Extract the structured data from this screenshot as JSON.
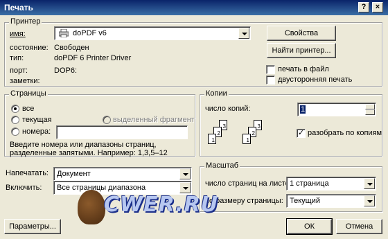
{
  "window": {
    "title": "Печать",
    "help_button": "?",
    "close_button": "×"
  },
  "printer": {
    "legend": "Принтер",
    "name_label": "имя:",
    "name_value": "doPDF v6",
    "status_label": "состояние:",
    "status_value": "Свободен",
    "type_label": "тип:",
    "type_value": "doPDF  6 Printer Driver",
    "port_label": "порт:",
    "port_value": "DOP6:",
    "notes_label": "заметки:",
    "properties_button": "Свойства",
    "find_printer_button": "Найти принтер...",
    "print_to_file_label": "печать в файл",
    "duplex_label": "двусторонняя печать"
  },
  "pages": {
    "legend": "Страницы",
    "all_label": "все",
    "current_label": "текущая",
    "selection_label": "выделенный фрагмент",
    "numbers_label": "номера:",
    "numbers_value": "",
    "hint": "Введите номера или диапазоны страниц, разделенные запятыми. Например: 1,3,5–12"
  },
  "copies": {
    "legend": "Копии",
    "count_label": "число копий:",
    "count_value": "1",
    "collate_label": "разобрать по копиям"
  },
  "print_what": {
    "print_label": "Напечатать:",
    "print_value": "Документ",
    "include_label": "Включить:",
    "include_value": "Все страницы диапазона"
  },
  "zoom": {
    "legend": "Масштаб",
    "pages_per_sheet_label": "число страниц на листе:",
    "pages_per_sheet_value": "1 страница",
    "scale_label": "по размеру страницы:",
    "scale_value": "Текущий"
  },
  "footer": {
    "options_button": "Параметры...",
    "ok_button": "ОК",
    "cancel_button": "Отмена",
    "watermark": "CWER.RU"
  }
}
